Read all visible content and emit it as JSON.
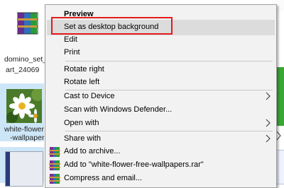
{
  "files": {
    "rar_file": {
      "line1": "domino_set_",
      "line2": "art_24069"
    },
    "flower_file": {
      "line1": "white-flower",
      "line2": "-wallpaper"
    }
  },
  "menu": {
    "items": [
      {
        "label": "Preview",
        "bold": true
      },
      {
        "label": "Set as desktop background",
        "highlighted": true
      },
      {
        "label": "Edit"
      },
      {
        "label": "Print"
      },
      {
        "label": "Rotate right"
      },
      {
        "label": "Rotate left"
      },
      {
        "label": "Cast to Device",
        "submenu": true
      },
      {
        "label": "Scan with Windows Defender..."
      },
      {
        "label": "Open with",
        "submenu": true
      },
      {
        "label": "Share with",
        "submenu": true
      },
      {
        "label": "Add to archive...",
        "icon": "winrar-icon"
      },
      {
        "label": "Add to \"white-flower-free-wallpapers.rar\"",
        "icon": "winrar-icon"
      },
      {
        "label": "Compress and email...",
        "icon": "winrar-icon"
      }
    ]
  },
  "colors": {
    "menu_background": "#f2f2f2",
    "highlight": "#dcdcdc",
    "annotation_box": "#e41b1b",
    "selected_file_background": "#cde6f7"
  }
}
